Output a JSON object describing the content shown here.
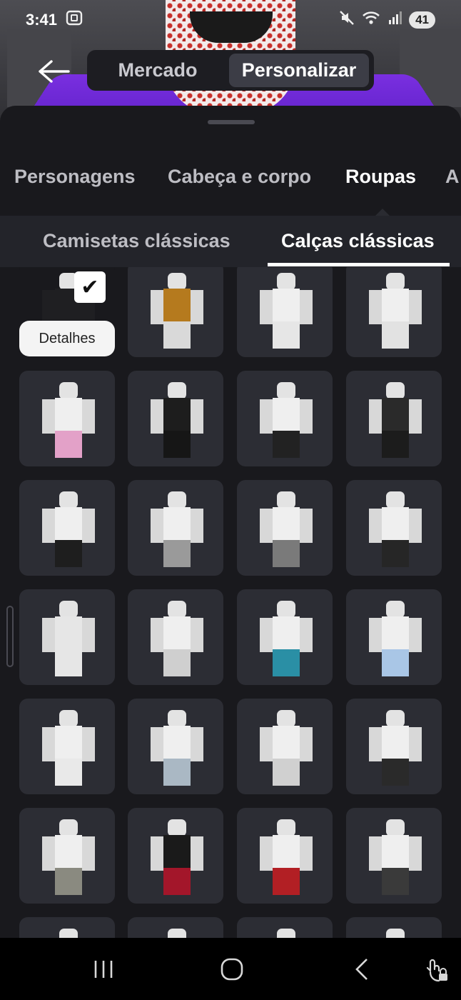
{
  "status_bar": {
    "time": "3:41",
    "battery": "41",
    "icons": [
      "screenshot-icon",
      "mute-icon",
      "wifi-icon",
      "signal-icon"
    ]
  },
  "header": {
    "tabs": [
      {
        "label": "Mercado",
        "active": false
      },
      {
        "label": "Personalizar",
        "active": true
      }
    ]
  },
  "categories": [
    {
      "label": "Personagens",
      "active": false
    },
    {
      "label": "Cabeça e corpo",
      "active": false
    },
    {
      "label": "Roupas",
      "active": true
    },
    {
      "label": "A",
      "active": false
    }
  ],
  "subcategories": [
    {
      "label": "Camisetas clássicas",
      "active": false
    },
    {
      "label": "Calças clássicas",
      "active": true
    }
  ],
  "details_label": "Detalhes",
  "items": [
    {
      "pants": "#1b1b1b",
      "torso": "#1f1f22",
      "selected": true
    },
    {
      "pants": "#d9d9d9",
      "torso": "#b57a1e"
    },
    {
      "pants": "#e6e6e6",
      "torso": "#efefef"
    },
    {
      "pants": "#e2e2e2",
      "torso": "#efefef"
    },
    {
      "pants": "#e3a1c8",
      "torso": "#efefef"
    },
    {
      "pants": "#161616",
      "torso": "#1d1d1d"
    },
    {
      "pants": "#222222",
      "torso": "#efefef"
    },
    {
      "pants": "#1c1c1c",
      "torso": "#2a2a2a"
    },
    {
      "pants": "#1e1e1e",
      "torso": "#efefef"
    },
    {
      "pants": "#9a9a9a",
      "torso": "#efefef"
    },
    {
      "pants": "#7a7a7a",
      "torso": "#efefef"
    },
    {
      "pants": "#262626",
      "torso": "#efefef"
    },
    {
      "pants": "#e6e6e6",
      "torso": "#e6e6e6"
    },
    {
      "pants": "#cfcfcf",
      "torso": "#efefef"
    },
    {
      "pants": "#2a8fa5",
      "torso": "#efefef"
    },
    {
      "pants": "#a9c6e6",
      "torso": "#efefef"
    },
    {
      "pants": "#e9e9e9",
      "torso": "#efefef"
    },
    {
      "pants": "#aab8c4",
      "torso": "#efefef"
    },
    {
      "pants": "#d0d0d0",
      "torso": "#efefef"
    },
    {
      "pants": "#2a2a2a",
      "torso": "#efefef"
    },
    {
      "pants": "#8a8a80",
      "torso": "#efefef"
    },
    {
      "pants": "#a3162a",
      "torso": "#1a1a1a"
    },
    {
      "pants": "#b21f24",
      "torso": "#efefef"
    },
    {
      "pants": "#3a3a3a",
      "torso": "#efefef"
    },
    {
      "pants": "#d4d4d4",
      "torso": "#efefef"
    },
    {
      "pants": "#d4d4d4",
      "torso": "#efefef"
    },
    {
      "pants": "#d4d4d4",
      "torso": "#efefef"
    },
    {
      "pants": "#d4d4d4",
      "torso": "#efefef"
    }
  ],
  "colors": {
    "background": "#19191d",
    "tile": "#2c2d34",
    "accent_purple": "#6a28d6"
  }
}
